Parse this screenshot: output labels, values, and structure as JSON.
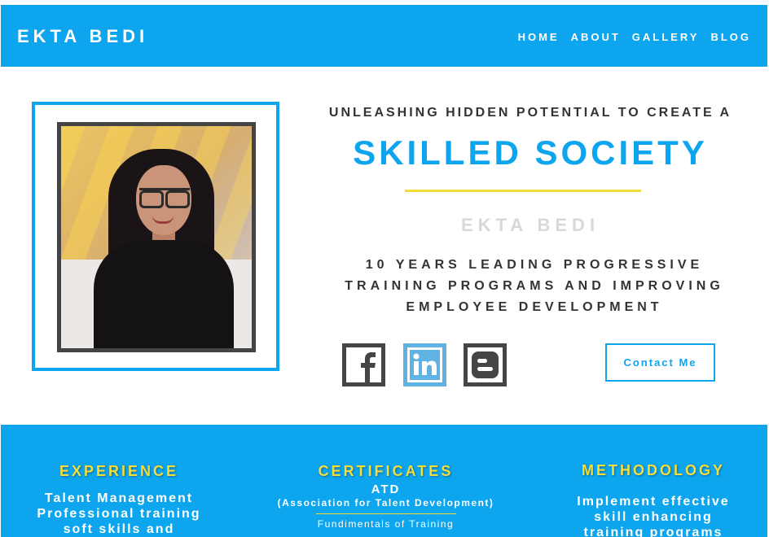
{
  "header": {
    "brand": "EKTA BEDI",
    "nav": [
      "HOME",
      "ABOUT",
      "GALLERY",
      "BLOG"
    ]
  },
  "hero": {
    "tagline": "UNLEASHING HIDDEN POTENTIAL TO CREATE A",
    "headline": "SKILLED SOCIETY",
    "name": "EKTA BEDI",
    "summary_lines": [
      "10 YEARS LEADING PROGRESSIVE",
      "TRAINING PROGRAMS AND IMPROVING",
      "EMPLOYEE DEVELOPMENT"
    ],
    "social_icons": [
      "facebook-icon",
      "linkedin-icon",
      "blogger-icon"
    ],
    "contact_label": "Contact Me"
  },
  "features": {
    "experience": {
      "title": "EXPERIENCE",
      "lines": [
        "Talent Management",
        "Professional training",
        "soft skills and"
      ]
    },
    "certificates": {
      "title": "CERTIFICATES",
      "name": "ATD",
      "org": "(Association for Talent Development)",
      "item": "Fundimentals of Training"
    },
    "methodology": {
      "title": "METHODOLOGY",
      "lines": [
        "Implement effective",
        "skill enhancing",
        "training programs"
      ]
    }
  },
  "colors": {
    "accent": "#0ca5ee",
    "highlight": "#f4dc3b",
    "dark": "#333333",
    "muted": "#d8d8d8",
    "linkedin": "#5fb3e3",
    "icon_dark": "#454545"
  }
}
